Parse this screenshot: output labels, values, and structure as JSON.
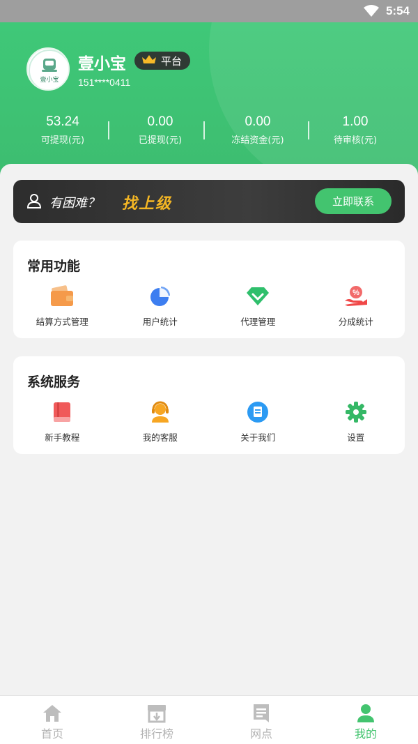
{
  "status_bar": {
    "time": "5:54"
  },
  "profile": {
    "username": "壹小宝",
    "badge": "平台",
    "phone": "151****0411",
    "avatar_text": "壹小宝"
  },
  "stats": [
    {
      "value": "53.24",
      "label": "可提现(元)"
    },
    {
      "value": "0.00",
      "label": "已提现(元)"
    },
    {
      "value": "0.00",
      "label": "冻结资金(元)"
    },
    {
      "value": "1.00",
      "label": "待审核(元)"
    }
  ],
  "banner": {
    "question": "有困难？",
    "highlight": "找上级",
    "button": "立即联系"
  },
  "common_functions": {
    "title": "常用功能",
    "items": [
      {
        "label": "结算方式管理",
        "icon": "wallet-icon"
      },
      {
        "label": "用户统计",
        "icon": "pie-chart-icon"
      },
      {
        "label": "代理管理",
        "icon": "diamond-icon"
      },
      {
        "label": "分成统计",
        "icon": "percent-hand-icon"
      }
    ]
  },
  "system_services": {
    "title": "系统服务",
    "items": [
      {
        "label": "新手教程",
        "icon": "book-icon"
      },
      {
        "label": "我的客服",
        "icon": "headset-icon"
      },
      {
        "label": "关于我们",
        "icon": "document-icon"
      },
      {
        "label": "设置",
        "icon": "gear-icon"
      }
    ]
  },
  "tabbar": [
    {
      "label": "首页",
      "icon": "home-icon",
      "active": false
    },
    {
      "label": "排行榜",
      "icon": "store-icon",
      "active": false
    },
    {
      "label": "网点",
      "icon": "list-icon",
      "active": false
    },
    {
      "label": "我的",
      "icon": "person-icon",
      "active": true
    }
  ],
  "colors": {
    "brand_green": "#43c46f",
    "header_green": "#3fc878",
    "highlight_gold": "#f5b724",
    "inactive_gray": "#b3b3b3"
  }
}
